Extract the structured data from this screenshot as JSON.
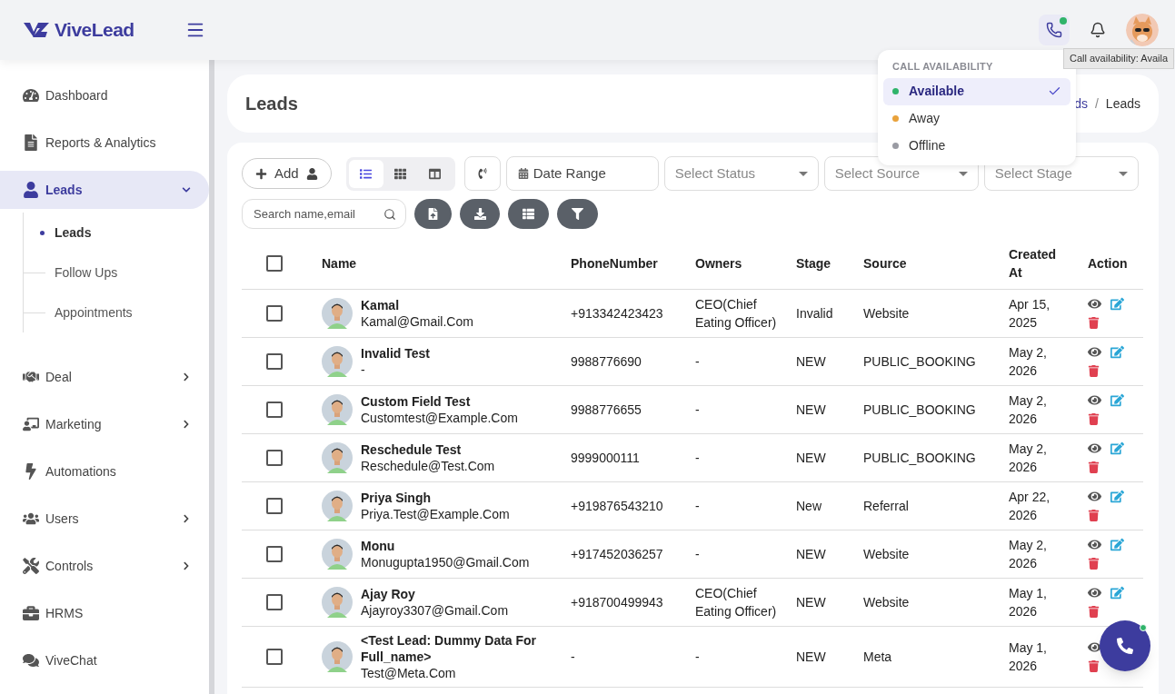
{
  "brand": {
    "name": "ViveLead"
  },
  "header": {
    "tooltip": "Call availability: Availa"
  },
  "call_availability": {
    "title": "CALL AVAILABILITY",
    "options": [
      {
        "label": "Available",
        "color": "#2fb36a",
        "selected": true
      },
      {
        "label": "Away",
        "color": "#e9a23b",
        "selected": false
      },
      {
        "label": "Offline",
        "color": "#9a9ba3",
        "selected": false
      }
    ]
  },
  "sidebar": {
    "items": [
      {
        "label": "Dashboard",
        "selected": false,
        "expandable": false
      },
      {
        "label": "Reports & Analytics",
        "selected": false,
        "expandable": false
      },
      {
        "label": "Leads",
        "selected": true,
        "expandable": true,
        "expanded": true,
        "children": [
          {
            "label": "Leads",
            "selected": true
          },
          {
            "label": "Follow Ups",
            "selected": false
          },
          {
            "label": "Appointments",
            "selected": false
          }
        ]
      },
      {
        "label": "Deal",
        "selected": false,
        "expandable": true,
        "expanded": false
      },
      {
        "label": "Marketing",
        "selected": false,
        "expandable": true,
        "expanded": false
      },
      {
        "label": "Automations",
        "selected": false,
        "expandable": false
      },
      {
        "label": "Users",
        "selected": false,
        "expandable": true,
        "expanded": false
      },
      {
        "label": "Controls",
        "selected": false,
        "expandable": true,
        "expanded": false
      },
      {
        "label": "HRMS",
        "selected": false,
        "expandable": false
      },
      {
        "label": "ViveChat",
        "selected": false,
        "expandable": false
      }
    ]
  },
  "page": {
    "title": "Leads",
    "breadcrumb": [
      "ds",
      "Leads"
    ],
    "separator": "/"
  },
  "toolbar": {
    "add_label": "Add",
    "view_modes": [
      {
        "selected": true
      },
      {
        "selected": false
      },
      {
        "selected": false
      }
    ],
    "date_range": "Date Range",
    "selects": [
      "Select Status",
      "Select Source",
      "Select Stage"
    ],
    "search": {
      "placeholder": "Search name,email"
    }
  },
  "table": {
    "select_all_checked": false,
    "columns": [
      "Name",
      "PhoneNumber",
      "Owners",
      "Stage",
      "Source",
      "Created At",
      "Action"
    ],
    "rows": [
      {
        "checked": false,
        "name": "Kamal",
        "email": "Kamal@Gmail.Com",
        "phone": "+913342423423",
        "owners": "CEO(Chief Eating Officer)",
        "stage": "Invalid",
        "source": "Website",
        "created": "Apr 15, 2025",
        "actions": [
          {
            "kind": "view"
          },
          {
            "kind": "edit"
          },
          {
            "kind": "delete"
          }
        ]
      },
      {
        "checked": false,
        "name": "Invalid Test",
        "email": "-",
        "phone": "9988776690",
        "owners": "-",
        "stage": "NEW",
        "source": "PUBLIC_BOOKING",
        "created": "May 2, 2026",
        "actions": [
          {
            "kind": "view"
          },
          {
            "kind": "edit"
          },
          {
            "kind": "delete"
          }
        ]
      },
      {
        "checked": false,
        "name": "Custom Field Test",
        "email": "Customtest@Example.Com",
        "phone": "9988776655",
        "owners": "-",
        "stage": "NEW",
        "source": "PUBLIC_BOOKING",
        "created": "May 2, 2026",
        "actions": [
          {
            "kind": "view"
          },
          {
            "kind": "edit"
          },
          {
            "kind": "delete"
          }
        ]
      },
      {
        "checked": false,
        "name": "Reschedule Test",
        "email": "Reschedule@Test.Com",
        "phone": "9999000111",
        "owners": "-",
        "stage": "NEW",
        "source": "PUBLIC_BOOKING",
        "created": "May 2, 2026",
        "actions": [
          {
            "kind": "view"
          },
          {
            "kind": "edit"
          },
          {
            "kind": "delete"
          }
        ]
      },
      {
        "checked": false,
        "name": "Priya Singh",
        "email": "Priya.Test@Example.Com",
        "phone": "+919876543210",
        "owners": "-",
        "stage": "New",
        "source": "Referral",
        "created": "Apr 22, 2026",
        "actions": [
          {
            "kind": "view"
          },
          {
            "kind": "edit"
          },
          {
            "kind": "delete"
          }
        ]
      },
      {
        "checked": false,
        "name": "Monu",
        "email": "Monugupta1950@Gmail.Com",
        "phone": "+917452036257",
        "owners": "-",
        "stage": "NEW",
        "source": "Website",
        "created": "May 2, 2026",
        "actions": [
          {
            "kind": "view"
          },
          {
            "kind": "edit"
          },
          {
            "kind": "delete"
          }
        ]
      },
      {
        "checked": false,
        "name": "Ajay Roy",
        "email": "Ajayroy3307@Gmail.Com",
        "phone": "+918700499943",
        "owners": "CEO(Chief Eating Officer)",
        "stage": "NEW",
        "source": "Website",
        "created": "May 1, 2026",
        "actions": [
          {
            "kind": "view"
          },
          {
            "kind": "edit"
          },
          {
            "kind": "delete"
          }
        ]
      },
      {
        "checked": false,
        "name": "<Test Lead: Dummy Data For Full_name>",
        "email": "Test@Meta.Com",
        "phone": "-",
        "owners": "-",
        "stage": "NEW",
        "source": "Meta",
        "created": "May 1, 2026",
        "actions": [
          {
            "kind": "view"
          },
          {
            "kind": "delete"
          }
        ]
      }
    ]
  }
}
